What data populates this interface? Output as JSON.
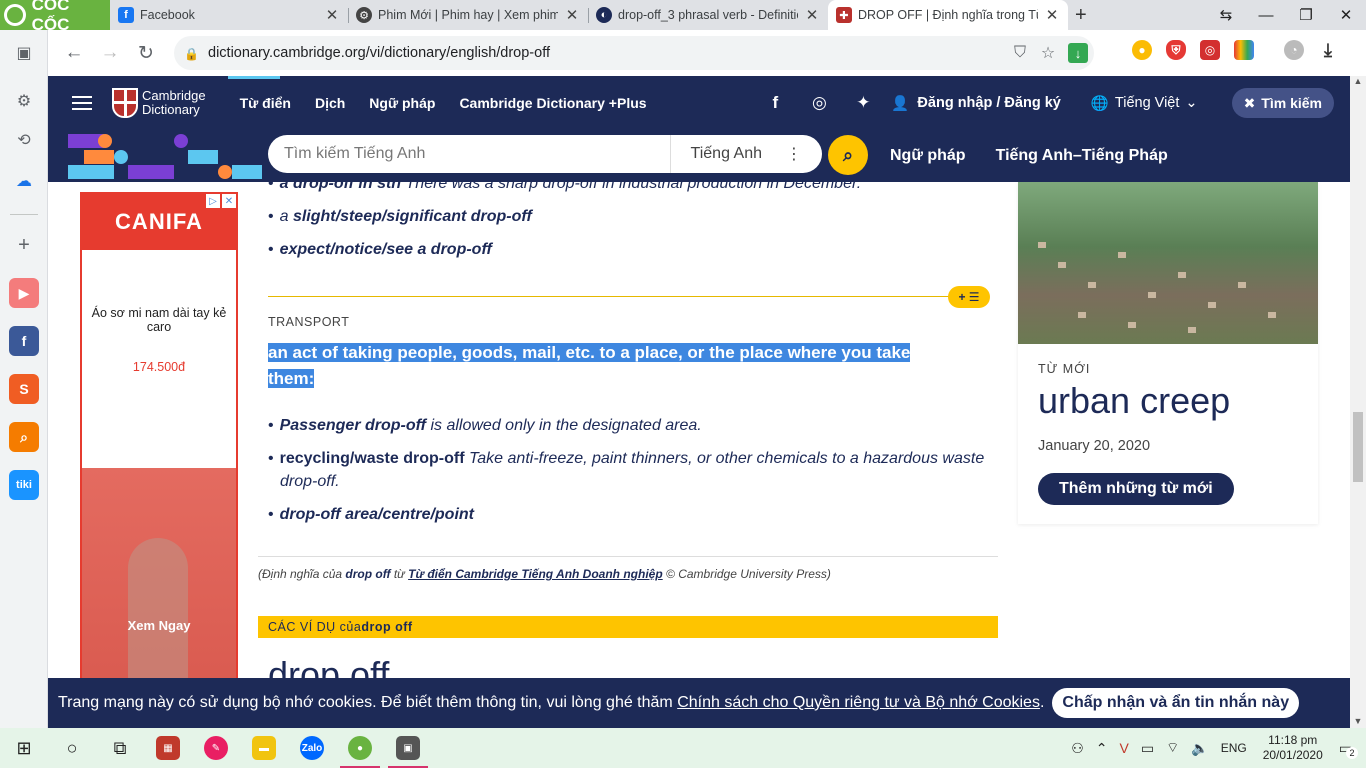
{
  "browser": {
    "brand": "CỐC CỐC",
    "tabs": [
      {
        "title": "Facebook"
      },
      {
        "title": "Phim Mới | Phim hay | Xem phim m"
      },
      {
        "title": "drop-off_3 phrasal verb - Definitio"
      },
      {
        "title": "DROP OFF | Định nghĩa trong Từ đ"
      }
    ],
    "url": "dictionary.cambridge.org/vi/dictionary/english/drop-off"
  },
  "header": {
    "logo_line1": "Cambridge",
    "logo_line2": "Dictionary",
    "nav": [
      "Từ điển",
      "Dịch",
      "Ngữ pháp",
      "Cambridge Dictionary +Plus"
    ],
    "login": "Đăng nhập / Đăng ký",
    "language": "Tiếng Việt",
    "search_toggle": "Tìm kiếm"
  },
  "search": {
    "placeholder": "Tìm kiếm Tiếng Anh",
    "dict_select": "Tiếng Anh",
    "links": [
      "Ngữ pháp",
      "Tiếng Anh–Tiếng Pháp"
    ]
  },
  "ad": {
    "brand": "CANIFA",
    "product": "Áo sơ mi nam dài tay kẻ caro",
    "price": "174.500đ",
    "cta": "Xem Ngay"
  },
  "entry": {
    "examples_top": [
      {
        "bold": "a drop-off in sth",
        "text": " There was a sharp drop-off in industrial production in December."
      },
      {
        "pre": "a ",
        "bold": "slight/steep/significant drop-off",
        "text": ""
      },
      {
        "bold": "expect/notice/see a drop-off",
        "text": ""
      }
    ],
    "category": "TRANSPORT",
    "definition": "an act of taking people, goods, mail, etc. to a place, or the place where you take them:",
    "examples": [
      {
        "bold": "Passenger drop-off",
        "text": " is allowed only in the designated area."
      },
      {
        "bold": "recycling/waste drop-off",
        "text": " Take anti-freeze, paint thinners, or other chemicals to a hazardous waste drop-off."
      },
      {
        "bold": "drop-off area/centre/point",
        "text": ""
      }
    ],
    "citation": {
      "prefix": "(Định nghĩa của ",
      "word": "drop off",
      "mid": " từ ",
      "source": "Từ điển Cambridge Tiếng Anh Doanh nghiệp",
      "suffix": " © Cambridge University Press)"
    },
    "examples_header_pre": "CÁC VÍ DỤ của",
    "examples_header_word": "drop off",
    "headword": "drop off"
  },
  "new_word": {
    "kicker": "TỪ MỚI",
    "word": "urban creep",
    "date": "January 20, 2020",
    "button": "Thêm những từ mới"
  },
  "cookie": {
    "text": "Trang mạng này có sử dụng bộ nhớ cookies. Để biết thêm thông tin, vui lòng ghé thăm ",
    "link": "Chính sách cho Quyền riêng tư và Bộ nhớ Cookies",
    "after": ".",
    "accept": "Chấp nhận và ẩn tin nhắn này"
  },
  "taskbar": {
    "lang": "ENG",
    "time": "11:18 pm",
    "date": "20/01/2020",
    "notifications": "2"
  },
  "colors": {
    "cambridge_navy": "#1d2a57",
    "accent_yellow": "#fec400",
    "selection_blue": "#3e87e0",
    "coccoc_green": "#69b340"
  }
}
